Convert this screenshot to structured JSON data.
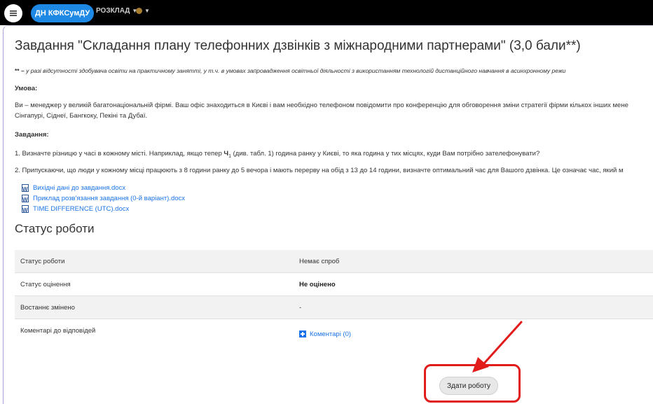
{
  "navbar": {
    "menu_icon": "hamburger-icon",
    "brand": "ДН КФКСумДУ",
    "schedule_label": "РОЗКЛАД",
    "language_icon": "globe-icon"
  },
  "assignment": {
    "title": "Завдання \"Складання плану телефонних дзвінків з міжнародними партнерами\" (3,0 бали**)",
    "note_mark": "** –",
    "note_text": " у разі відсутності здобувача освіти на практичному занятті, у т.ч. в умовах запровадження освітньої діяльності з використанням технологій дистанційного навчання в асинхронному режи",
    "condition_heading": "Умова:",
    "condition_line1": "Ви – менеджер у великій багатонаціональній фірмі. Ваш офіс знаходиться в Києві і вам необхідно телефоном повідомити про конференцію для обговорення зміни стратегії фірми кількох інших мене",
    "condition_line2": "Сінгапурі, Сіднеї, Бангкоку, Пекіні  та Дубаї.",
    "task_heading": "Завдання:",
    "task1_prefix": "1. Визначте різницю у часі в кожному місті. Наприклад, якщо тепер ",
    "task1_bold": "Ч",
    "task1_sub": "1",
    "task1_suffix": " (див. табл. 1) година ранку у Києві, то яка година у тих місцях, куди Вам потрібно зателефонувати?",
    "task2": "2. Припускаючи, що люди у кожному місці працюють з 8 години ранку до 5 вечора і мають перерву на обід з 13 до 14 години, визначте оптимальний час для Вашого дзвінка. Це означає час, який м",
    "attachments": [
      "Вихідні дані до завдання.docx",
      "Приклад розв'язання завдання (0-й варіант).docx",
      "TIME DIFFERENCE (UTC).docx"
    ]
  },
  "status": {
    "heading": "Статус роботи",
    "rows": [
      {
        "label": "Статус роботи",
        "value": "Немає спроб"
      },
      {
        "label": "Статус оцінення",
        "value": "Не оцінено"
      },
      {
        "label": "Востаннє змінено",
        "value": "-"
      },
      {
        "label": "Коментарі до відповідей",
        "value": "Коментарі (0)"
      }
    ],
    "submit_label": "Здати роботу"
  },
  "colors": {
    "brand": "#1e88e5",
    "link": "#1a73e8",
    "highlight": "#e21b1b"
  }
}
